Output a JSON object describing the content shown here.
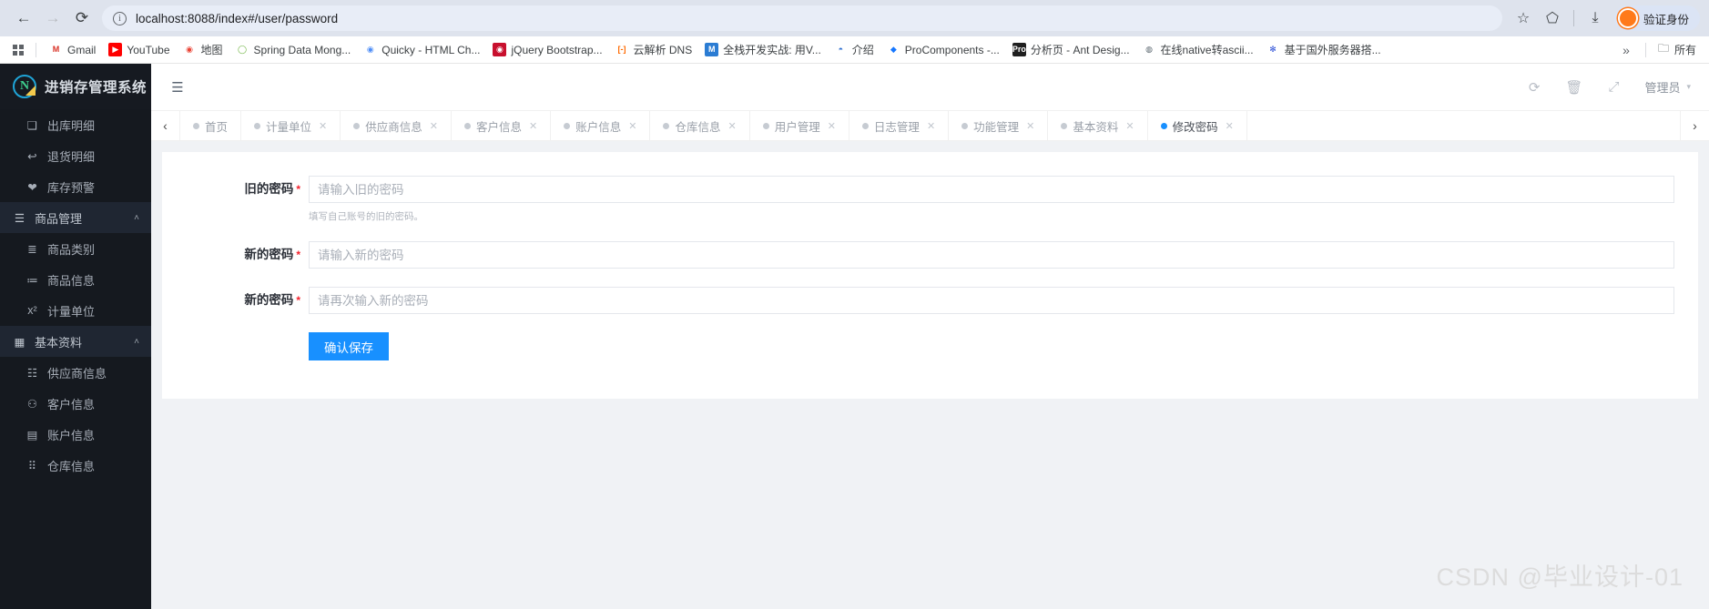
{
  "browser": {
    "url": "localhost:8088/index#/user/password",
    "back_icon": "back-arrow-icon",
    "forward_icon": "forward-arrow-icon",
    "reload_icon": "reload-icon",
    "info_icon": "page-info-icon",
    "star_icon": "bookmark-star-icon",
    "extensions_icon": "extensions-puzzle-icon",
    "downloads_icon": "downloads-icon",
    "profile_label": "验证身份"
  },
  "bookmarks": {
    "apps_label": "apps-grid-icon",
    "overflow_label": "»",
    "all_label": "所有",
    "items": [
      {
        "label": "Gmail",
        "fav": "M",
        "fav_bg": "#ffffff",
        "fav_fg": "#d93025"
      },
      {
        "label": "YouTube",
        "fav": "▶",
        "fav_bg": "#ff0000",
        "fav_fg": "#ffffff"
      },
      {
        "label": "地图",
        "fav": "◉",
        "fav_bg": "#ffffff",
        "fav_fg": "#ea4335"
      },
      {
        "label": "Spring Data Mong...",
        "fav": "◯",
        "fav_bg": "#ffffff",
        "fav_fg": "#6db33f"
      },
      {
        "label": "Quicky - HTML Ch...",
        "fav": "◉",
        "fav_bg": "#ffffff",
        "fav_fg": "#4f8ef7"
      },
      {
        "label": "jQuery Bootstrap...",
        "fav": "◉",
        "fav_bg": "#c8102e",
        "fav_fg": "#ffffff"
      },
      {
        "label": "云解析 DNS",
        "fav": "[-]",
        "fav_bg": "#ffffff",
        "fav_fg": "#ff6a00"
      },
      {
        "label": "全栈开发实战: 用V...",
        "fav": "M",
        "fav_bg": "#2b7cd3",
        "fav_fg": "#ffffff"
      },
      {
        "label": "介绍",
        "fav": "◓",
        "fav_bg": "#ffffff",
        "fav_fg": "#2f6fd0"
      },
      {
        "label": "ProComponents -...",
        "fav": "◆",
        "fav_bg": "#ffffff",
        "fav_fg": "#1677ff"
      },
      {
        "label": "分析页 - Ant Desig...",
        "fav": "Pro",
        "fav_bg": "#1f1f1f",
        "fav_fg": "#ffffff"
      },
      {
        "label": "在线native转ascii...",
        "fav": "◍",
        "fav_bg": "#ffffff",
        "fav_fg": "#5b6770"
      },
      {
        "label": "基于国外服务器搭...",
        "fav": "✻",
        "fav_bg": "#ffffff",
        "fav_fg": "#2b4fd6"
      }
    ]
  },
  "sidebar": {
    "brand": {
      "title": "进销存管理系统",
      "mark": "N"
    },
    "items": [
      {
        "label": "出库明细",
        "icon": "file-copy-icon",
        "glyph": "❏",
        "level": "sub",
        "type": "link"
      },
      {
        "label": "退货明细",
        "icon": "return-arrow-icon",
        "glyph": "↩",
        "level": "sub",
        "type": "link"
      },
      {
        "label": "库存预警",
        "icon": "alert-heart-icon",
        "glyph": "❤",
        "level": "sub",
        "type": "link"
      },
      {
        "label": "商品管理",
        "icon": "list-icon",
        "glyph": "☰",
        "level": "group",
        "type": "group",
        "caret": "˄"
      },
      {
        "label": "商品类别",
        "icon": "category-list-icon",
        "glyph": "≣",
        "level": "sub",
        "type": "link"
      },
      {
        "label": "商品信息",
        "icon": "ordered-list-icon",
        "glyph": "≔",
        "level": "sub",
        "type": "link"
      },
      {
        "label": "计量单位",
        "icon": "superscript-icon",
        "glyph": "x²",
        "level": "sub",
        "type": "link"
      },
      {
        "label": "基本资料",
        "icon": "grid-blocks-icon",
        "glyph": "▦",
        "level": "group",
        "type": "group",
        "caret": "˄"
      },
      {
        "label": "供应商信息",
        "icon": "list-bullets-icon",
        "glyph": "☷",
        "level": "sub",
        "type": "link"
      },
      {
        "label": "客户信息",
        "icon": "users-group-icon",
        "glyph": "⚇",
        "level": "sub",
        "type": "link"
      },
      {
        "label": "账户信息",
        "icon": "id-card-icon",
        "glyph": "▤",
        "level": "sub",
        "type": "link"
      },
      {
        "label": "仓库信息",
        "icon": "warehouse-grid-icon",
        "glyph": "⠿",
        "level": "sub",
        "type": "link"
      }
    ]
  },
  "topbar": {
    "collapse_icon": "menu-collapse-icon",
    "refresh_icon": "refresh-icon",
    "trash_icon": "trash-icon",
    "fullscreen_icon": "fullscreen-icon",
    "user_label": "管理员",
    "user_caret": "▾"
  },
  "tabstrip": {
    "left_arrow": "‹",
    "right_arrow": "›",
    "close_glyph": "✕",
    "tabs": [
      {
        "label": "首页",
        "active": false,
        "closable": false
      },
      {
        "label": "计量单位",
        "active": false,
        "closable": true
      },
      {
        "label": "供应商信息",
        "active": false,
        "closable": true
      },
      {
        "label": "客户信息",
        "active": false,
        "closable": true
      },
      {
        "label": "账户信息",
        "active": false,
        "closable": true
      },
      {
        "label": "仓库信息",
        "active": false,
        "closable": true
      },
      {
        "label": "用户管理",
        "active": false,
        "closable": true
      },
      {
        "label": "日志管理",
        "active": false,
        "closable": true
      },
      {
        "label": "功能管理",
        "active": false,
        "closable": true
      },
      {
        "label": "基本资料",
        "active": false,
        "closable": true
      },
      {
        "label": "修改密码",
        "active": true,
        "closable": true
      }
    ]
  },
  "form": {
    "fields": [
      {
        "label": "旧的密码",
        "required": "*",
        "placeholder": "请输入旧的密码",
        "value": "",
        "help": "填写自己账号的旧的密码。"
      },
      {
        "label": "新的密码",
        "required": "*",
        "placeholder": "请输入新的密码",
        "value": "",
        "help": ""
      },
      {
        "label": "新的密码",
        "required": "*",
        "placeholder": "请再次输入新的密码",
        "value": "",
        "help": ""
      }
    ],
    "submit_label": "确认保存"
  },
  "watermark": {
    "text": "CSDN @毕业设计-01"
  },
  "colors": {
    "accent": "#1890ff",
    "sidebar_bg": "#15191f",
    "sidebar_group_bg": "#1f2632",
    "page_bg": "#f0f2f5",
    "required_red": "#f5222d"
  }
}
